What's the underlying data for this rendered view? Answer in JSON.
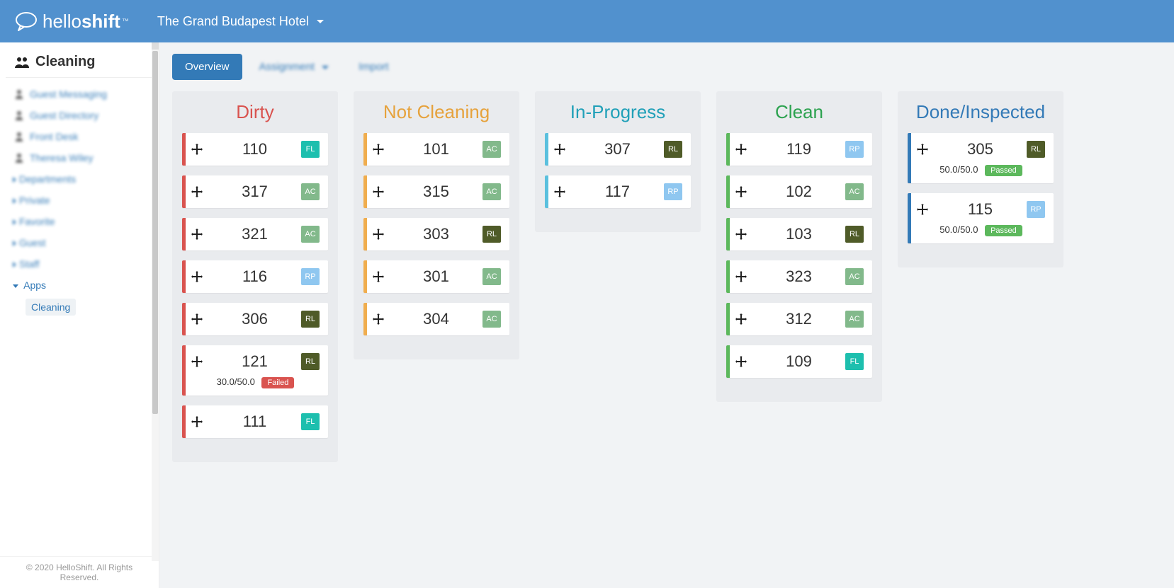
{
  "header": {
    "brand_prefix": "hello",
    "brand_bold": "shift",
    "hotel_name": "The Grand Budapest Hotel"
  },
  "sidebar": {
    "title": "Cleaning",
    "nav_items": [
      {
        "label": "Guest Messaging"
      },
      {
        "label": "Guest Directory"
      },
      {
        "label": "Front Desk"
      },
      {
        "label": "Theresa Wiley"
      }
    ],
    "collapsibles": [
      {
        "label": "Departments",
        "open": false
      },
      {
        "label": "Private",
        "open": false
      },
      {
        "label": "Favorite",
        "open": false
      },
      {
        "label": "Guest",
        "open": false
      },
      {
        "label": "Staff",
        "open": false
      }
    ],
    "apps_label": "Apps",
    "apps_sub": "Cleaning",
    "footer": "© 2020 HelloShift. All Rights Reserved."
  },
  "tabs": {
    "overview": "Overview",
    "assignment": "Assignment",
    "import": "Import"
  },
  "columns": [
    {
      "key": "dirty",
      "title": "Dirty",
      "title_class": "col-dirty",
      "border_class": "bl-dirty",
      "cards": [
        {
          "room": "110",
          "badge": "FL"
        },
        {
          "room": "317",
          "badge": "AC"
        },
        {
          "room": "321",
          "badge": "AC"
        },
        {
          "room": "116",
          "badge": "RP"
        },
        {
          "room": "306",
          "badge": "RL"
        },
        {
          "room": "121",
          "badge": "RL",
          "score": "30.0/50.0",
          "status": "Failed"
        },
        {
          "room": "111",
          "badge": "FL"
        }
      ]
    },
    {
      "key": "not",
      "title": "Not Cleaning",
      "title_class": "col-not",
      "border_class": "bl-not",
      "cards": [
        {
          "room": "101",
          "badge": "AC"
        },
        {
          "room": "315",
          "badge": "AC"
        },
        {
          "room": "303",
          "badge": "RL"
        },
        {
          "room": "301",
          "badge": "AC"
        },
        {
          "room": "304",
          "badge": "AC"
        }
      ]
    },
    {
      "key": "prog",
      "title": "In-Progress",
      "title_class": "col-prog",
      "border_class": "bl-prog",
      "cards": [
        {
          "room": "307",
          "badge": "RL"
        },
        {
          "room": "117",
          "badge": "RP"
        }
      ]
    },
    {
      "key": "clean",
      "title": "Clean",
      "title_class": "col-clean",
      "border_class": "bl-clean",
      "cards": [
        {
          "room": "119",
          "badge": "RP"
        },
        {
          "room": "102",
          "badge": "AC"
        },
        {
          "room": "103",
          "badge": "RL"
        },
        {
          "room": "323",
          "badge": "AC"
        },
        {
          "room": "312",
          "badge": "AC"
        },
        {
          "room": "109",
          "badge": "FL"
        }
      ]
    },
    {
      "key": "done",
      "title": "Done/Inspected",
      "title_class": "col-done",
      "border_class": "bl-done",
      "cards": [
        {
          "room": "305",
          "badge": "RL",
          "score": "50.0/50.0",
          "status": "Passed"
        },
        {
          "room": "115",
          "badge": "RP",
          "score": "50.0/50.0",
          "status": "Passed"
        }
      ]
    }
  ]
}
